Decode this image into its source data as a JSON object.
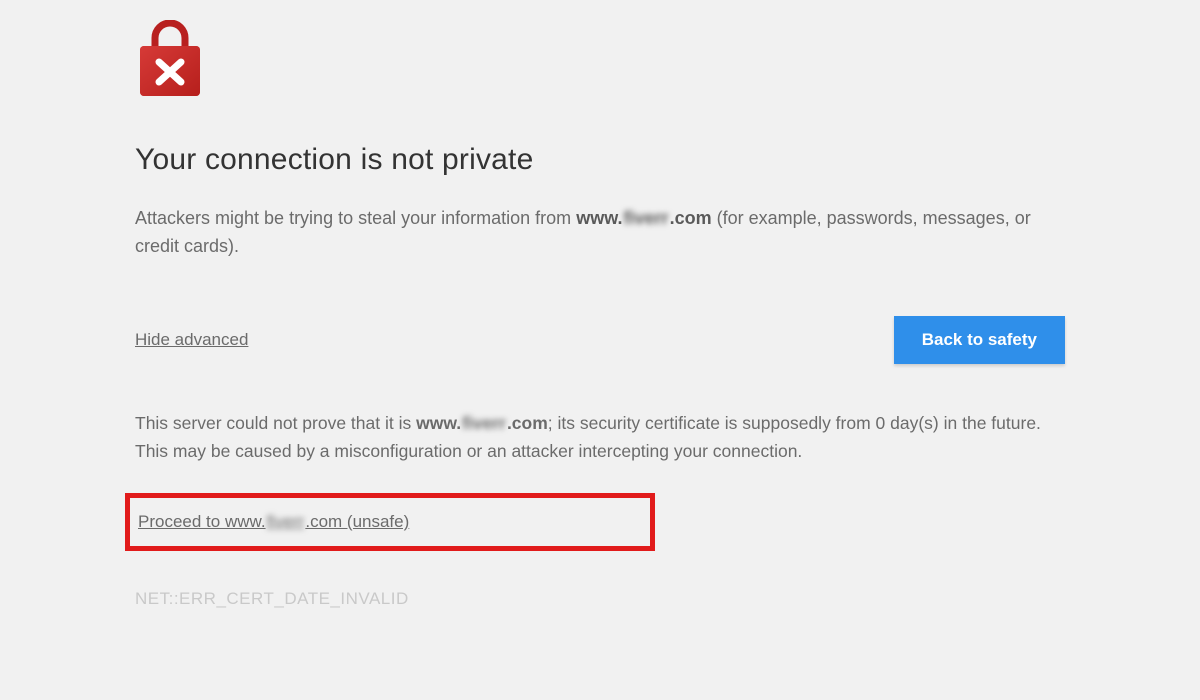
{
  "heading": "Your connection is not private",
  "warning": {
    "pre": "Attackers might be trying to steal your information from ",
    "domain_prefix": "www.",
    "domain_blur": "fiverr",
    "domain_suffix": ".com",
    "post": " (for example, passwords, messages, or credit cards)."
  },
  "actions": {
    "hide_advanced": "Hide advanced",
    "back_to_safety": "Back to safety"
  },
  "details": {
    "pre": "This server could not prove that it is ",
    "domain_prefix": "www.",
    "domain_blur": "fiverr",
    "domain_suffix": ".com",
    "post": "; its security certificate is supposedly from 0 day(s) in the future. This may be caused by a misconfiguration or an attacker intercepting your connection."
  },
  "proceed": {
    "pre": "Proceed to www.",
    "domain_blur": "fiverr",
    "post": ".com (unsafe)"
  },
  "error_code": "NET::ERR_CERT_DATE_INVALID"
}
